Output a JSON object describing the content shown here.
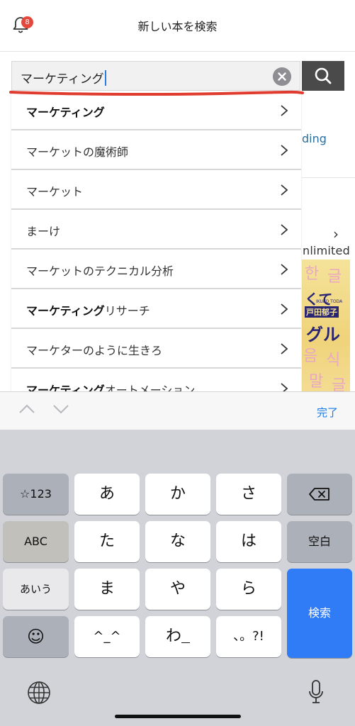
{
  "header": {
    "title": "新しい本を検索",
    "badge_count": "8"
  },
  "search": {
    "query": "マーケティング",
    "icon": "magnifier-icon",
    "clear_icon": "clear-x-icon"
  },
  "suggestions": [
    {
      "bold": "マーケティング",
      "rest": ""
    },
    {
      "bold": "",
      "rest": "マーケットの魔術師"
    },
    {
      "bold": "",
      "rest": "マーケット"
    },
    {
      "bold": "",
      "rest": "まーけ"
    },
    {
      "bold": "",
      "rest": "マーケットのテクニカル分析"
    },
    {
      "bold": "マーケティング",
      "rest": "リサーチ"
    },
    {
      "bold": "",
      "rest": "マーケターのように生きろ"
    },
    {
      "bold": "マーケティング",
      "rest": "オートメーション"
    }
  ],
  "background": {
    "link_fragment": "ding",
    "unlimited_fragment": "nlimited",
    "book_text": "くて",
    "book_author": "戸田郁子",
    "book_author_roman": "IKUKO TODA",
    "book_title_fragment": "グル"
  },
  "toolbar": {
    "done_label": "完了"
  },
  "keyboard": {
    "rows": [
      [
        "☆123",
        "あ",
        "か",
        "さ",
        "⌫"
      ],
      [
        "ABC",
        "た",
        "な",
        "は",
        "空白"
      ],
      [
        "あいう",
        "ま",
        "や",
        "ら",
        "検索"
      ],
      [
        "☺",
        "^_^",
        "わ_",
        "、。?!"
      ]
    ],
    "k_123": "☆123",
    "k_a": "あ",
    "k_ka": "か",
    "k_sa": "さ",
    "k_abc": "ABC",
    "k_ta": "た",
    "k_na": "な",
    "k_ha": "は",
    "k_space": "空白",
    "k_aiu": "あいう",
    "k_ma": "ま",
    "k_ya": "や",
    "k_ra": "ら",
    "k_search": "検索",
    "k_emoji": "☺",
    "k_kaomoji": "^_^",
    "k_wa": "わ",
    "k_punct": "、。?!"
  },
  "colors": {
    "accent_blue": "#2f7cf6",
    "badge_red": "#e4483c",
    "underline_red": "#e03b2f",
    "search_button": "#4a4a4a"
  }
}
